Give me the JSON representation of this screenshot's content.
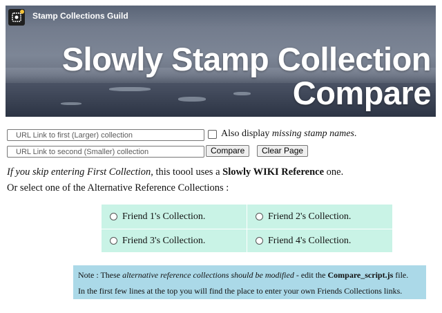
{
  "header": {
    "guild_name": "Stamp Collections Guild",
    "title_line1": "Slowly Stamp Collection",
    "title_line2": "Compare"
  },
  "form": {
    "url1_placeholder": "URL Link to first (Larger) collection",
    "url2_placeholder": "URL Link to second (Smaller) collection",
    "display_missing_prefix": "Also display ",
    "display_missing_italic": "missing stamp names",
    "display_missing_suffix": ".",
    "compare_label": "Compare",
    "clear_label": "Clear Page"
  },
  "info": {
    "skip_italic": "If you skip entering First Collection",
    "skip_middle": ", this toool uses a ",
    "skip_bold": "Slowly WIKI Reference",
    "skip_end": " one.",
    "or_select": "Or select one of the Alternative Reference Collections :"
  },
  "friends": [
    {
      "label": "Friend 1's Collection."
    },
    {
      "label": "Friend 2's Collection."
    },
    {
      "label": "Friend 3's Collection."
    },
    {
      "label": "Friend 4's Collection."
    }
  ],
  "note": {
    "prefix": "Note : These ",
    "italic": "alternative reference collections should be modified",
    "middle": " - edit the ",
    "bold": "Compare_script.js",
    "suffix": " file.",
    "line2": "In the first few lines at the top you will find the place to enter your own Friends Collections links."
  },
  "colors": {
    "grid_bg": "#c9f3e6",
    "note_bg": "#abd9e8"
  }
}
